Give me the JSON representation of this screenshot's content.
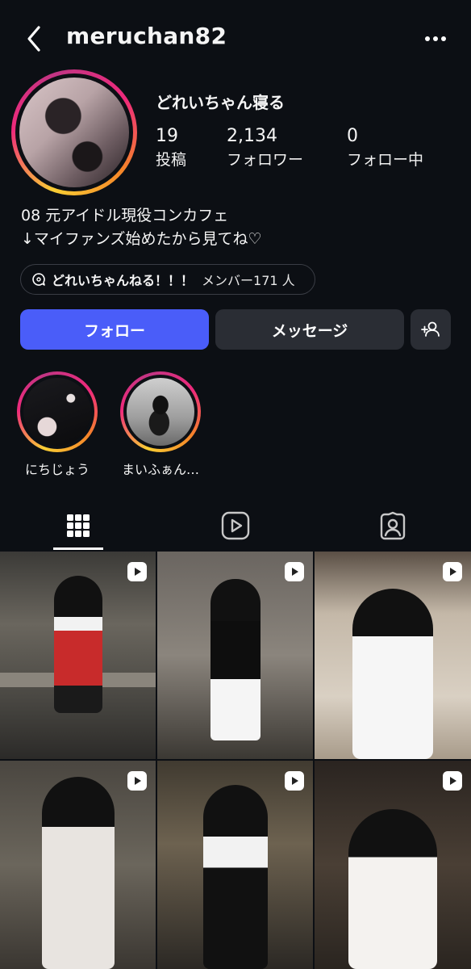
{
  "header": {
    "username": "meruchan82",
    "back_icon": "chevron-left-icon",
    "more_icon": "more-horizontal-icon"
  },
  "profile": {
    "display_name": "どれいちゃん寝る",
    "stats": [
      {
        "value": "19",
        "label": "投稿"
      },
      {
        "value": "2,134",
        "label": "フォロワー"
      },
      {
        "value": "0",
        "label": "フォロー中"
      }
    ],
    "bio_lines": [
      "08 元アイドル現役コンカフェ",
      "↓マイファンズ始めたから見てね♡"
    ],
    "channel": {
      "name": "どれいちゃんねる！！！",
      "members": "メンバー171 人"
    }
  },
  "actions": {
    "follow_label": "フォロー",
    "message_label": "メッセージ"
  },
  "highlights": [
    {
      "label": "にちじょう"
    },
    {
      "label": "まいふぁん…"
    }
  ],
  "tabs": [
    {
      "name": "grid",
      "icon": "grid-icon",
      "active": true
    },
    {
      "name": "reels",
      "icon": "reels-icon",
      "active": false
    },
    {
      "name": "tagged",
      "icon": "tagged-icon",
      "active": false
    }
  ],
  "colors": {
    "background": "#0c0f14",
    "follow_button": "#4a5df9",
    "secondary_button": "#2a2d34"
  }
}
